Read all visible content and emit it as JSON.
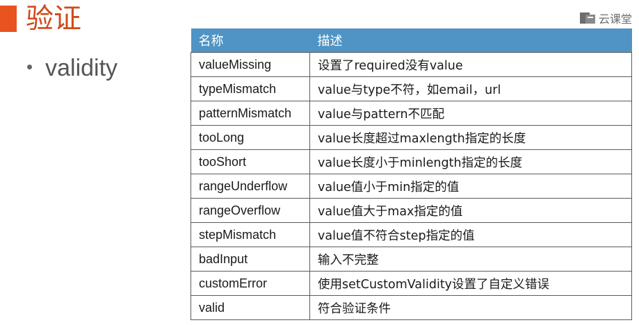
{
  "slide": {
    "title": "验证",
    "bullet": "validity",
    "logo_text": "云课堂"
  },
  "table": {
    "headers": [
      "名称",
      "描述"
    ],
    "rows": [
      {
        "name": "valueMissing",
        "desc": "设置了required没有value"
      },
      {
        "name": "typeMismatch",
        "desc": "value与type不符，如email，url"
      },
      {
        "name": "patternMismatch",
        "desc": "value与pattern不匹配"
      },
      {
        "name": "tooLong",
        "desc": "value长度超过maxlength指定的长度"
      },
      {
        "name": "tooShort",
        "desc": "value长度小于minlength指定的长度"
      },
      {
        "name": "rangeUnderflow",
        "desc": "value值小于min指定的值"
      },
      {
        "name": "rangeOverflow",
        "desc": "value值大于max指定的值"
      },
      {
        "name": "stepMismatch",
        "desc": "value值不符合step指定的值"
      },
      {
        "name": "badInput",
        "desc": "输入不完整"
      },
      {
        "name": "customError",
        "desc": "使用setCustomValidity设置了自定义错误"
      },
      {
        "name": "valid",
        "desc": "符合验证条件"
      }
    ]
  },
  "colors": {
    "accent": "#e8531f",
    "header_bg": "#4f94c4"
  }
}
